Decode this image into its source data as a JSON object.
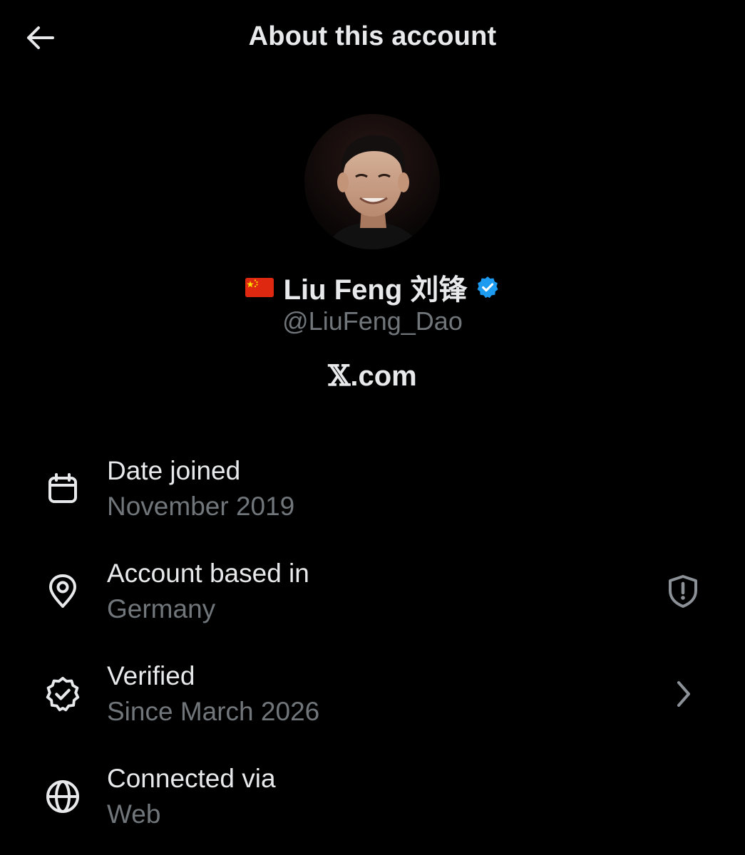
{
  "header": {
    "title": "About this account",
    "back_icon": "arrow-left-icon"
  },
  "profile": {
    "flag": "🇨🇳",
    "display_name": "Liu Feng 刘锋",
    "verified": true,
    "verified_color": "#1d9bf0",
    "handle": "@LiuFeng_Dao",
    "platform_mark": "𝕏",
    "platform_text": ".com"
  },
  "details": [
    {
      "icon": "calendar-icon",
      "label": "Date joined",
      "value": "November 2019",
      "trailing": null
    },
    {
      "icon": "location-pin-icon",
      "label": "Account based in",
      "value": "Germany",
      "trailing": "shield-alert-icon"
    },
    {
      "icon": "verified-check-icon",
      "label": "Verified",
      "value": "Since March 2026",
      "trailing": "chevron-right-icon"
    },
    {
      "icon": "globe-icon",
      "label": "Connected via",
      "value": "Web",
      "trailing": null
    }
  ],
  "colors": {
    "background": "#000000",
    "primary_text": "#e7e9ea",
    "secondary_text": "#71767b"
  }
}
